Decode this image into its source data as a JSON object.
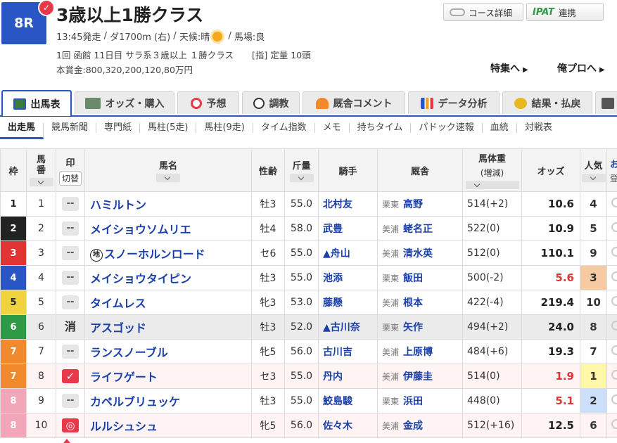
{
  "race": {
    "number": "8R",
    "title": "3歳以上1勝クラス",
    "start": "13:45発走",
    "course": "ダ1700m (右)",
    "weather_label": "天候:晴",
    "track_condition": "馬場:良",
    "session": "1回 函館 11日目 サラ系３歳以上 １勝クラス",
    "conditions": "[指] 定量 10頭",
    "prize": "本賞金:800,320,200,120,80万円"
  },
  "header_buttons": {
    "course_details": "コース詳細",
    "ipat_logo": "IPAT",
    "ipat_label": "連携"
  },
  "links": {
    "special": "特集へ",
    "mypro": "俺プロへ"
  },
  "tabs": [
    {
      "label": "出馬表",
      "active": true
    },
    {
      "label": "オッズ・購入"
    },
    {
      "label": "予想"
    },
    {
      "label": "調教"
    },
    {
      "label": "厩舎コメント"
    },
    {
      "label": "データ分析"
    },
    {
      "label": "結果・払戻"
    }
  ],
  "subnav": [
    "出走馬",
    "競馬新聞",
    "専門紙",
    "馬柱(5走)",
    "馬柱(9走)",
    "タイム指数",
    "メモ",
    "持ちタイム",
    "パドック速報",
    "血統",
    "対戦表"
  ],
  "columns": {
    "waku": "枠",
    "umaban": "馬番",
    "mark": "印",
    "mark_switch": "切替",
    "horse": "馬名",
    "sexage": "性齢",
    "weight": "斤量",
    "jockey": "騎手",
    "stable": "厩舎",
    "body_weight": "馬体重",
    "body_weight_sub": "(増減)",
    "odds": "オッズ",
    "popularity": "人気",
    "extra": "お",
    "extra_sub": "登"
  },
  "colors": {
    "accent": "#2a55c5",
    "red": "#e23434",
    "waku": [
      "#ffffff",
      "#222222",
      "#e23434",
      "#2a55c5",
      "#f1d33f",
      "#2e9a45",
      "#f08a2c",
      "#f2a6b7"
    ]
  },
  "entries": [
    {
      "waku": "1",
      "umaban": "1",
      "mark": "--",
      "horse": "ハミルトン",
      "chi": "",
      "sexage": "牡3",
      "weight": "55.0",
      "jockey": "北村友",
      "region": "栗東",
      "trainer": "高野",
      "body_weight": "514(+2)",
      "odds": "10.6",
      "pop": "4"
    },
    {
      "waku": "2",
      "umaban": "2",
      "mark": "--",
      "horse": "メイショウソムリエ",
      "chi": "",
      "sexage": "牡4",
      "weight": "58.0",
      "jockey": "武豊",
      "region": "美浦",
      "trainer": "蛯名正",
      "body_weight": "522(0)",
      "odds": "10.9",
      "pop": "5"
    },
    {
      "waku": "3",
      "umaban": "3",
      "mark": "--",
      "horse": "スノーホルンロード",
      "chi": "地",
      "sexage": "セ6",
      "weight": "55.0",
      "jockey": "▲舟山",
      "region": "美浦",
      "trainer": "清水英",
      "body_weight": "512(0)",
      "odds": "110.1",
      "pop": "9"
    },
    {
      "waku": "4",
      "umaban": "4",
      "mark": "--",
      "horse": "メイショウタイピン",
      "chi": "",
      "sexage": "牡3",
      "weight": "55.0",
      "jockey": "池添",
      "region": "栗東",
      "trainer": "飯田",
      "body_weight": "500(-2)",
      "odds": "5.6",
      "pop": "3"
    },
    {
      "waku": "5",
      "umaban": "5",
      "mark": "--",
      "horse": "タイムレス",
      "chi": "",
      "sexage": "牝3",
      "weight": "53.0",
      "jockey": "藤懸",
      "region": "美浦",
      "trainer": "根本",
      "body_weight": "422(-4)",
      "odds": "219.4",
      "pop": "10"
    },
    {
      "waku": "6",
      "umaban": "6",
      "mark": "消",
      "horse": "アスゴッド",
      "chi": "",
      "sexage": "牡3",
      "weight": "52.0",
      "jockey": "▲古川奈",
      "region": "栗東",
      "trainer": "矢作",
      "body_weight": "494(+2)",
      "odds": "24.0",
      "pop": "8"
    },
    {
      "waku": "7",
      "umaban": "7",
      "mark": "--",
      "horse": "ランスノーブル",
      "chi": "",
      "sexage": "牝5",
      "weight": "56.0",
      "jockey": "古川吉",
      "region": "美浦",
      "trainer": "上原博",
      "body_weight": "484(+6)",
      "odds": "19.3",
      "pop": "7"
    },
    {
      "waku": "7",
      "umaban": "8",
      "mark": "✓",
      "horse": "ライフゲート",
      "chi": "",
      "sexage": "セ3",
      "weight": "55.0",
      "jockey": "丹内",
      "region": "美浦",
      "trainer": "伊藤圭",
      "body_weight": "514(0)",
      "odds": "1.9",
      "pop": "1"
    },
    {
      "waku": "8",
      "umaban": "9",
      "mark": "--",
      "horse": "カペルブリュッケ",
      "chi": "",
      "sexage": "牡3",
      "weight": "55.0",
      "jockey": "鮫島駿",
      "region": "栗東",
      "trainer": "浜田",
      "body_weight": "448(0)",
      "odds": "5.1",
      "pop": "2"
    },
    {
      "waku": "8",
      "umaban": "10",
      "mark": "◎",
      "horse": "ルルシュシュ",
      "chi": "",
      "sexage": "牝5",
      "weight": "56.0",
      "jockey": "佐々木",
      "region": "美浦",
      "trainer": "金成",
      "body_weight": "512(+16)",
      "odds": "12.5",
      "pop": "6"
    }
  ]
}
